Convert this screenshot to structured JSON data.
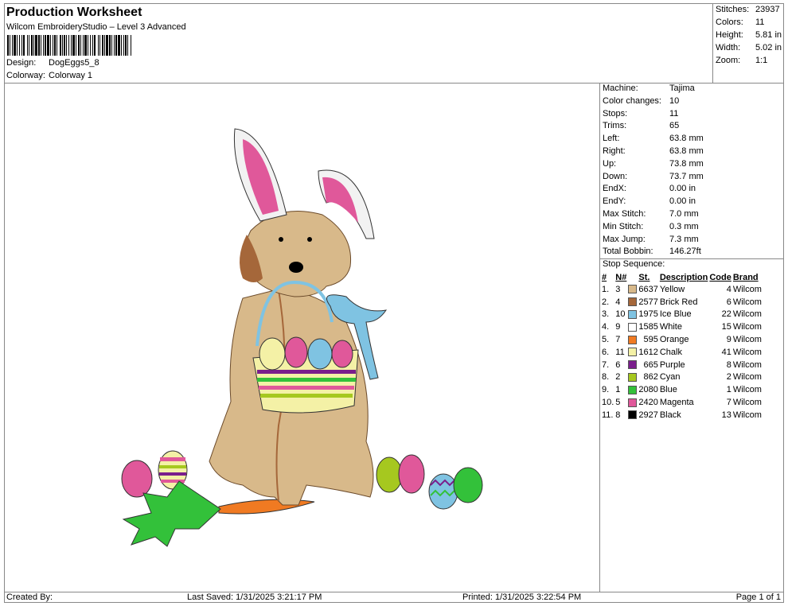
{
  "header": {
    "title": "Production Worksheet",
    "subtitle": "Wilcom EmbroideryStudio – Level 3 Advanced",
    "design_label": "Design:",
    "design_value": "DogEggs5_8",
    "colorway_label": "Colorway:",
    "colorway_value": "Colorway 1"
  },
  "stats": [
    {
      "label": "Stitches:",
      "value": "23937"
    },
    {
      "label": "Colors:",
      "value": "11"
    },
    {
      "label": "Height:",
      "value": "5.81 in"
    },
    {
      "label": "Width:",
      "value": "5.02 in"
    },
    {
      "label": "Zoom:",
      "value": "1:1"
    }
  ],
  "machine": [
    {
      "label": "Machine:",
      "value": "Tajima"
    },
    {
      "label": "Color changes:",
      "value": "10"
    },
    {
      "label": "Stops:",
      "value": "11"
    },
    {
      "label": "Trims:",
      "value": "65"
    },
    {
      "label": "Left:",
      "value": "63.8 mm"
    },
    {
      "label": "Right:",
      "value": "63.8 mm"
    },
    {
      "label": "Up:",
      "value": "73.8 mm"
    },
    {
      "label": "Down:",
      "value": "73.7 mm"
    },
    {
      "label": "EndX:",
      "value": "0.00 in"
    },
    {
      "label": "EndY:",
      "value": "0.00 in"
    },
    {
      "label": "Max Stitch:",
      "value": "7.0 mm"
    },
    {
      "label": "Min Stitch:",
      "value": "0.3 mm"
    },
    {
      "label": "Max Jump:",
      "value": "7.3 mm"
    },
    {
      "label": "Total Bobbin:",
      "value": "146.27ft"
    }
  ],
  "stop_sequence": {
    "title": "Stop Sequence:",
    "headers": {
      "idx": "#",
      "n": "N#",
      "st": "St.",
      "desc": "Description",
      "code": "Code",
      "brand": "Brand"
    },
    "rows": [
      {
        "idx": "1.",
        "n": "3",
        "color": "#d8b98a",
        "st": "6637",
        "desc": "Yellow",
        "code": "4",
        "brand": "Wilcom"
      },
      {
        "idx": "2.",
        "n": "4",
        "color": "#a5673a",
        "st": "2577",
        "desc": "Brick Red",
        "code": "6",
        "brand": "Wilcom"
      },
      {
        "idx": "3.",
        "n": "10",
        "color": "#7fc3e2",
        "st": "1975",
        "desc": "Ice Blue",
        "code": "22",
        "brand": "Wilcom"
      },
      {
        "idx": "4.",
        "n": "9",
        "color": "#ffffff",
        "st": "1585",
        "desc": "White",
        "code": "15",
        "brand": "Wilcom"
      },
      {
        "idx": "5.",
        "n": "7",
        "color": "#f07a22",
        "st": "595",
        "desc": "Orange",
        "code": "9",
        "brand": "Wilcom"
      },
      {
        "idx": "6.",
        "n": "11",
        "color": "#f4f1a6",
        "st": "1612",
        "desc": "Chalk",
        "code": "41",
        "brand": "Wilcom"
      },
      {
        "idx": "7.",
        "n": "6",
        "color": "#7a1e8c",
        "st": "665",
        "desc": "Purple",
        "code": "8",
        "brand": "Wilcom"
      },
      {
        "idx": "8.",
        "n": "2",
        "color": "#a6c81f",
        "st": "862",
        "desc": "Cyan",
        "code": "2",
        "brand": "Wilcom"
      },
      {
        "idx": "9.",
        "n": "1",
        "color": "#33c13a",
        "st": "2080",
        "desc": "Blue",
        "code": "1",
        "brand": "Wilcom"
      },
      {
        "idx": "10.",
        "n": "5",
        "color": "#e0589a",
        "st": "2420",
        "desc": "Magenta",
        "code": "7",
        "brand": "Wilcom"
      },
      {
        "idx": "11.",
        "n": "8",
        "color": "#000000",
        "st": "2927",
        "desc": "Black",
        "code": "13",
        "brand": "Wilcom"
      }
    ]
  },
  "footer": {
    "created": "Created By:",
    "saved": "Last Saved: 1/31/2025 3:21:17 PM",
    "printed": "Printed: 1/31/2025 3:22:54 PM",
    "page": "Page 1 of 1"
  }
}
